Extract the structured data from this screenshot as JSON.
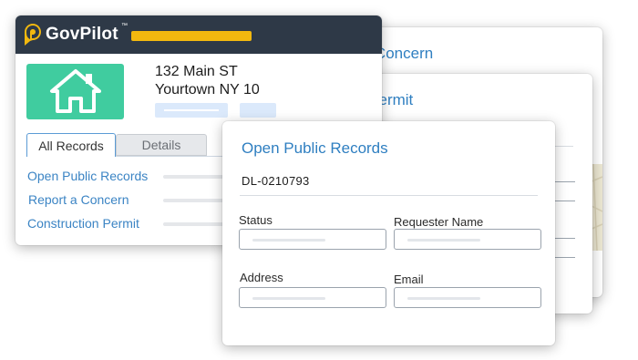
{
  "brand": {
    "name": "GovPilot",
    "tm": "™",
    "accent_color": "#f2b80f",
    "header_color": "#2e3947"
  },
  "property": {
    "icon": "house-icon",
    "tile_color": "#40cc9f",
    "address_line1": "132 Main ST",
    "address_line2": "Yourtown NY 10"
  },
  "tabs": [
    {
      "label": "All Records",
      "active": true
    },
    {
      "label": "Details",
      "active": false
    }
  ],
  "record_links": [
    "Open Public Records",
    "Report a Concern",
    "Construction Permit"
  ],
  "cards": {
    "concern_title": "Report a Concern",
    "permit_title": "Construction Permit"
  },
  "form": {
    "title": "Open Public Records",
    "record_id": "DL-0210793",
    "fields": [
      {
        "label": "Status"
      },
      {
        "label": "Requester Name"
      },
      {
        "label": "Address"
      },
      {
        "label": "Email"
      }
    ]
  },
  "link_color": "#3b84c4"
}
